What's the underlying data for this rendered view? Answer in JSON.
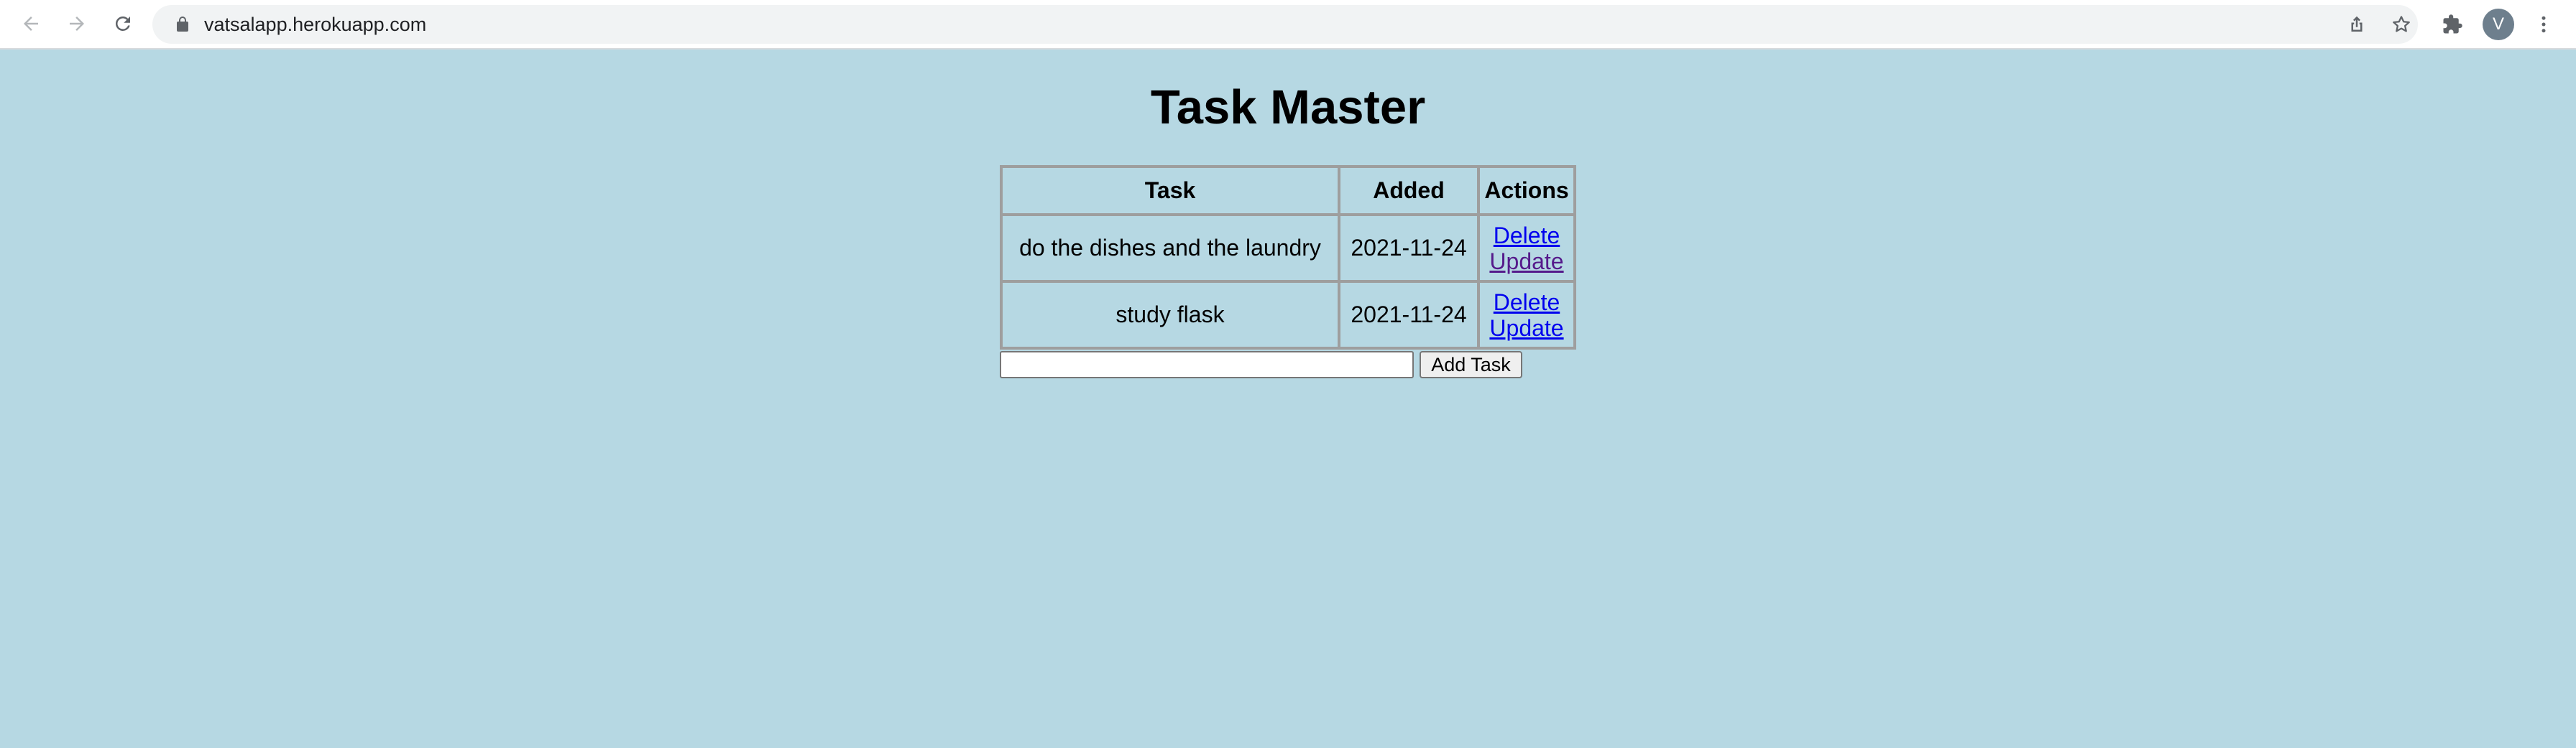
{
  "browser": {
    "url": "vatsalapp.herokuapp.com",
    "profile_initial": "V",
    "icons": [
      "back-arrow-icon",
      "forward-arrow-icon",
      "reload-icon",
      "lock-icon",
      "share-icon",
      "star-icon",
      "extensions-icon",
      "more-menu-icon"
    ]
  },
  "page": {
    "title": "Task Master",
    "background": "#b6d8e3"
  },
  "table": {
    "headers": [
      "Task",
      "Added",
      "Actions"
    ],
    "rows": [
      {
        "task": "do the dishes and the laundry",
        "added": "2021-11-24",
        "delete_label": "Delete",
        "update_label": "Update"
      },
      {
        "task": "study flask",
        "added": "2021-11-24",
        "delete_label": "Delete",
        "update_label": "Update"
      }
    ]
  },
  "form": {
    "input_value": "",
    "button_label": "Add Task"
  },
  "colors": {
    "link": "#0000ee",
    "visited_link": "#551a8b",
    "border": "#9e9e9e"
  }
}
